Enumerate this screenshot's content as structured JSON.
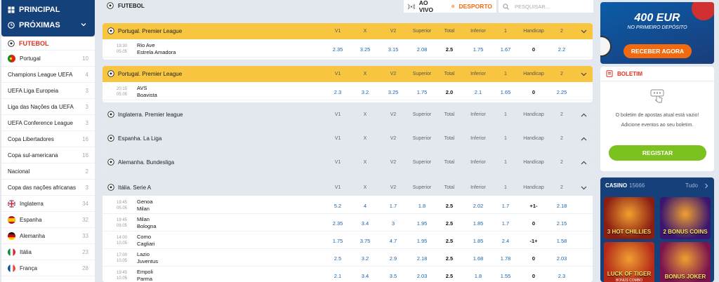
{
  "sidebar": {
    "principal": "PRINCIPAL",
    "proximas": "PRÓXIMAS",
    "sport": "FUTEBOL",
    "items": [
      {
        "label": "Portugal",
        "count": "10",
        "flag": "pt"
      },
      {
        "label": "Champions League UEFA",
        "count": "4"
      },
      {
        "label": "UEFA Liga Europeia",
        "count": "3"
      },
      {
        "label": "Liga das Nações da UEFA",
        "count": "3"
      },
      {
        "label": "UEFA Conference League",
        "count": "3"
      },
      {
        "label": "Copa Libertadores",
        "count": "16"
      },
      {
        "label": "Copa sul-americana",
        "count": "16"
      },
      {
        "label": "Nacional",
        "count": "2"
      },
      {
        "label": "Copa das nações africanas",
        "count": "3"
      },
      {
        "label": "Inglaterra",
        "count": "34",
        "flag": "gb"
      },
      {
        "label": "Espanha",
        "count": "32",
        "flag": "es"
      },
      {
        "label": "Alemanha",
        "count": "33",
        "flag": "de"
      },
      {
        "label": "Itália",
        "count": "23",
        "flag": "it"
      },
      {
        "label": "França",
        "count": "28",
        "flag": "fr"
      }
    ]
  },
  "topbar": {
    "title": "FUTEBOL",
    "live": "AO VIVO",
    "sport": "DESPORTO",
    "search_placeholder": "PESQUISAR..."
  },
  "columns": [
    "V1",
    "X",
    "V2",
    "Superior",
    "Total",
    "Inferior",
    "1",
    "Handicap",
    "2"
  ],
  "leagues": [
    {
      "name": "Portugal. Premier League",
      "gold": true,
      "open": true,
      "matches": [
        {
          "time": "19:30",
          "date": "05.05",
          "home": "Rio Ave",
          "away": "Estrela Amadora",
          "odds": [
            "2.35",
            "3.25",
            "3.15",
            "2.08",
            "2.5",
            "1.75",
            "1.67",
            "0",
            "2.2"
          ]
        }
      ]
    },
    {
      "name": "Portugal. Premier League",
      "gold": true,
      "open": true,
      "matches": [
        {
          "time": "20:15",
          "date": "05.05",
          "home": "AVS",
          "away": "Boavista",
          "odds": [
            "2.3",
            "3.2",
            "3.25",
            "1.75",
            "2.0",
            "2.1",
            "1.65",
            "0",
            "2.25"
          ]
        }
      ]
    },
    {
      "name": "Inglaterra. Premier league",
      "gold": false,
      "open": false,
      "matches": []
    },
    {
      "name": "Espanha. La Liga",
      "gold": false,
      "open": false,
      "matches": []
    },
    {
      "name": "Alemanha. Bundesliga",
      "gold": false,
      "open": false,
      "matches": []
    },
    {
      "name": "Itália. Serie A",
      "gold": false,
      "open": true,
      "matches": [
        {
          "time": "19:45",
          "date": "05.05",
          "home": "Genoa",
          "away": "Milan",
          "odds": [
            "5.2",
            "4",
            "1.7",
            "1.8",
            "2.5",
            "2.02",
            "1.7",
            "+1-",
            "2.18"
          ]
        },
        {
          "time": "19:45",
          "date": "09.05",
          "home": "Milan",
          "away": "Bologna",
          "odds": [
            "2.35",
            "3.4",
            "3",
            "1.95",
            "2.5",
            "1.85",
            "1.7",
            "0",
            "2.15"
          ]
        },
        {
          "time": "14:00",
          "date": "10.05",
          "home": "Como",
          "away": "Cagliari",
          "odds": [
            "1.75",
            "3.75",
            "4.7",
            "1.95",
            "2.5",
            "1.85",
            "2.4",
            "-1+",
            "1.58"
          ]
        },
        {
          "time": "17:00",
          "date": "10.05",
          "home": "Lazio",
          "away": "Juventus",
          "odds": [
            "2.5",
            "3.2",
            "2.9",
            "2.18",
            "2.5",
            "1.68",
            "1.78",
            "0",
            "2.03"
          ]
        },
        {
          "time": "19:45",
          "date": "10.05",
          "home": "Empoli",
          "away": "Parma",
          "odds": [
            "2.1",
            "3.4",
            "3.5",
            "2.03",
            "2.5",
            "1.8",
            "1.55",
            "0",
            "2.3"
          ]
        }
      ]
    }
  ],
  "promo": {
    "amount": "400 EUR",
    "subtitle": "NO PRIMEIRO DEPÓSITO",
    "button": "RECEBER AGORA"
  },
  "boletim": {
    "title": "BOLETIM",
    "empty_line1": "O boletim de apostas atual está vazio!",
    "empty_line2": "Adicione eventos ao seu boletim.",
    "button": "REGISTAR"
  },
  "casino": {
    "title": "CASINO",
    "count": "15666",
    "all": "Tudo",
    "games": [
      {
        "name": "3 HOT CHILLIES",
        "bg": "#8a1e14"
      },
      {
        "name": "2 BONUS COINS",
        "bg": "#3a1670"
      },
      {
        "name": "LUCK OF TIGER",
        "sub": "BONUS COMBO",
        "bg": "#b32a1a"
      },
      {
        "name": "BONUS JOKER",
        "bg": "#7a1450"
      }
    ]
  },
  "colors": {
    "navy": "#14417a",
    "gold": "#f7c53f",
    "odds_blue": "#1a62a8",
    "accent_red": "#e0301e",
    "green": "#7cc21e",
    "orange": "#f26a10"
  }
}
